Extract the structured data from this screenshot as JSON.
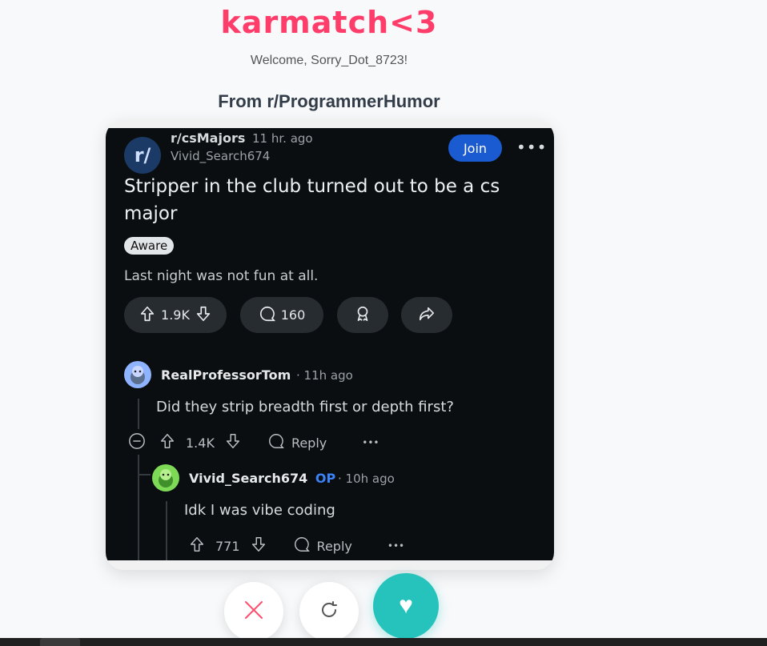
{
  "app": {
    "title": "karmatch<3",
    "welcome": "Welcome, Sorry_Dot_8723!",
    "source": "From r/ProgrammerHumor"
  },
  "post": {
    "subreddit_icon": "r/",
    "subreddit": "r/csMajors",
    "time": "11 hr. ago",
    "author": "Vivid_Search674",
    "join_label": "Join",
    "more_label": "•••",
    "title": "Stripper in the club turned out to be a cs major",
    "flair": "Aware",
    "body": "Last night was not fun at all.",
    "votes": "1.9K",
    "comments": "160"
  },
  "comments": [
    {
      "author": "RealProfessorTom",
      "time": "· 11h ago",
      "text": "Did they strip breadth first or depth first?",
      "votes": "1.4K",
      "reply_label": "Reply",
      "more_label": "•••"
    },
    {
      "author": "Vivid_Search674",
      "op_label": "OP",
      "time": "· 10h ago",
      "text": "Idk I was vibe coding",
      "votes": "771",
      "reply_label": "Reply",
      "more_label": "•••"
    }
  ],
  "actions": {
    "like_icon": "♥"
  },
  "colors": {
    "brand": "#ff3d6a",
    "like": "#25c3bb",
    "join": "#1a5bd2",
    "post_bg": "#0b0e11"
  }
}
